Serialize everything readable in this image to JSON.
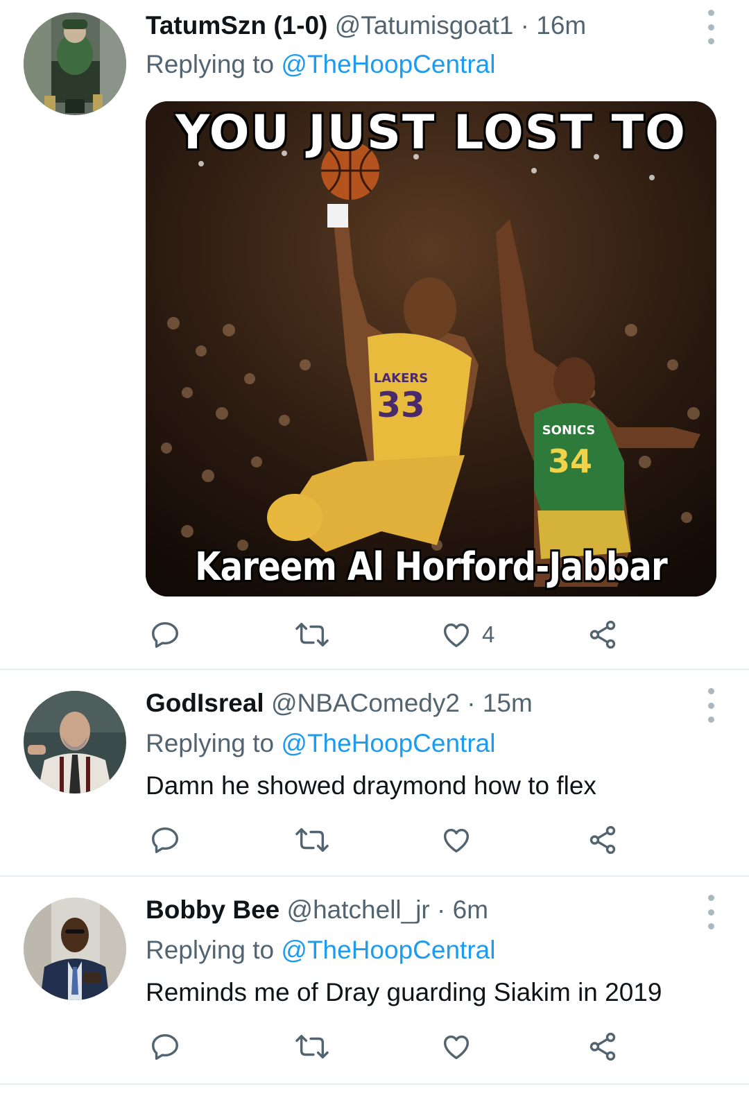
{
  "tweets": [
    {
      "display_name": "TatumSzn (1-0)",
      "handle": "@Tatumisgoat1",
      "separator": "·",
      "time": "16m",
      "replying_prefix": "Replying to",
      "replying_to": "@TheHoopCentral",
      "media": {
        "caption_top": "YOU JUST LOST TO",
        "caption_bottom": "Kareem Al Horford-Jabbar",
        "jersey_left_number": "33",
        "jersey_left_team": "LAKERS",
        "jersey_right_number": "34",
        "jersey_right_team": "SONICS"
      },
      "actions": {
        "reply_count": "",
        "retweet_count": "",
        "like_count": "4"
      },
      "avatar_icon": "avatar-gym-photo"
    },
    {
      "display_name": "GodIsreal",
      "handle": "@NBAComedy2",
      "separator": "·",
      "time": "15m",
      "replying_prefix": "Replying to",
      "replying_to": "@TheHoopCentral",
      "text": "Damn he showed draymond how to flex",
      "actions": {
        "reply_count": "",
        "retweet_count": "",
        "like_count": ""
      },
      "avatar_icon": "avatar-teacher-photo"
    },
    {
      "display_name": "Bobby Bee",
      "handle": "@hatchell_jr",
      "separator": "·",
      "time": "6m",
      "replying_prefix": "Replying to",
      "replying_to": "@TheHoopCentral",
      "text": "Reminds me of Dray guarding Siakim in 2019",
      "actions": {
        "reply_count": "",
        "retweet_count": "",
        "like_count": ""
      },
      "avatar_icon": "avatar-suit-photo"
    }
  ],
  "colors": {
    "primary_text": "#0f1419",
    "secondary_text": "#536471",
    "link": "#1d9bf0",
    "divider": "#e6ecf0"
  },
  "icons": [
    "reply-icon",
    "retweet-icon",
    "like-icon",
    "share-icon",
    "more-icon"
  ]
}
